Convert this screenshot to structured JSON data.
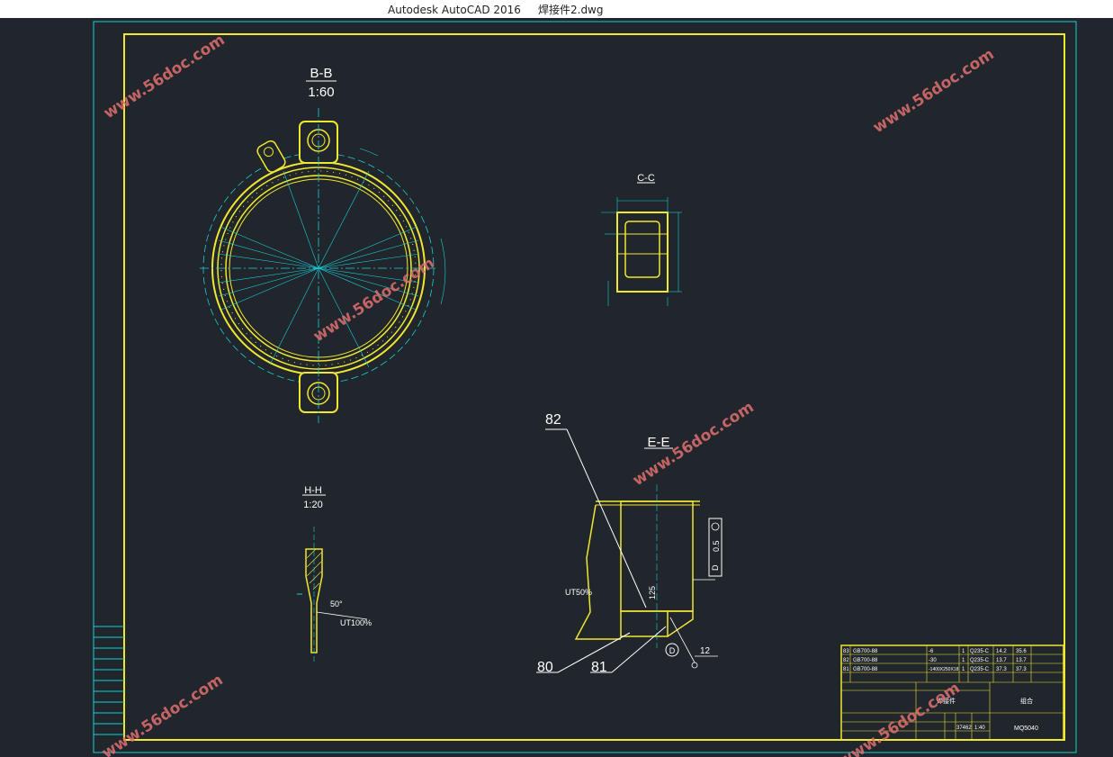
{
  "window": {
    "title": "Autodesk AutoCAD 2016     焊接件2.dwg"
  },
  "colors": {
    "background": "#21252c",
    "frame": "#f0e830",
    "dims": "#18d0d8",
    "leader": "#ffffff",
    "watermark": "#e07070"
  },
  "views": {
    "bb": {
      "name": "B-B",
      "scale": "1:60"
    },
    "cc": {
      "name": "C-C"
    },
    "hh": {
      "name": "H-H",
      "scale": "1:20",
      "angle": "50°",
      "ut": "UT100%"
    },
    "ee": {
      "name": "E-E",
      "ut": "UT50%",
      "tol": "0.5",
      "datum": "D",
      "dim125": "125",
      "dim12": "12"
    }
  },
  "callouts": [
    "82",
    "80",
    "81"
  ],
  "title_block": {
    "rows": [
      {
        "no": "83",
        "code": "GB700-88",
        "spec": "-6",
        "qty": "1",
        "mat": "Q235-C",
        "w1": "14.2",
        "w2": "35.6"
      },
      {
        "no": "82",
        "code": "GB700-88",
        "spec": "-30",
        "qty": "1",
        "mat": "Q235-C",
        "w1": "13.7",
        "w2": "13.7"
      },
      {
        "no": "81",
        "code": "GB700-88",
        "spec": "-1400X250X18",
        "qty": "1",
        "mat": "Q235-C",
        "w1": "37.3",
        "w2": "37.3"
      }
    ],
    "drawing_name": "焊接件",
    "org": "组合",
    "drawing_no": "MQ5040",
    "weight": "37462",
    "scale": "1:40"
  },
  "watermark": "www.56doc.com"
}
